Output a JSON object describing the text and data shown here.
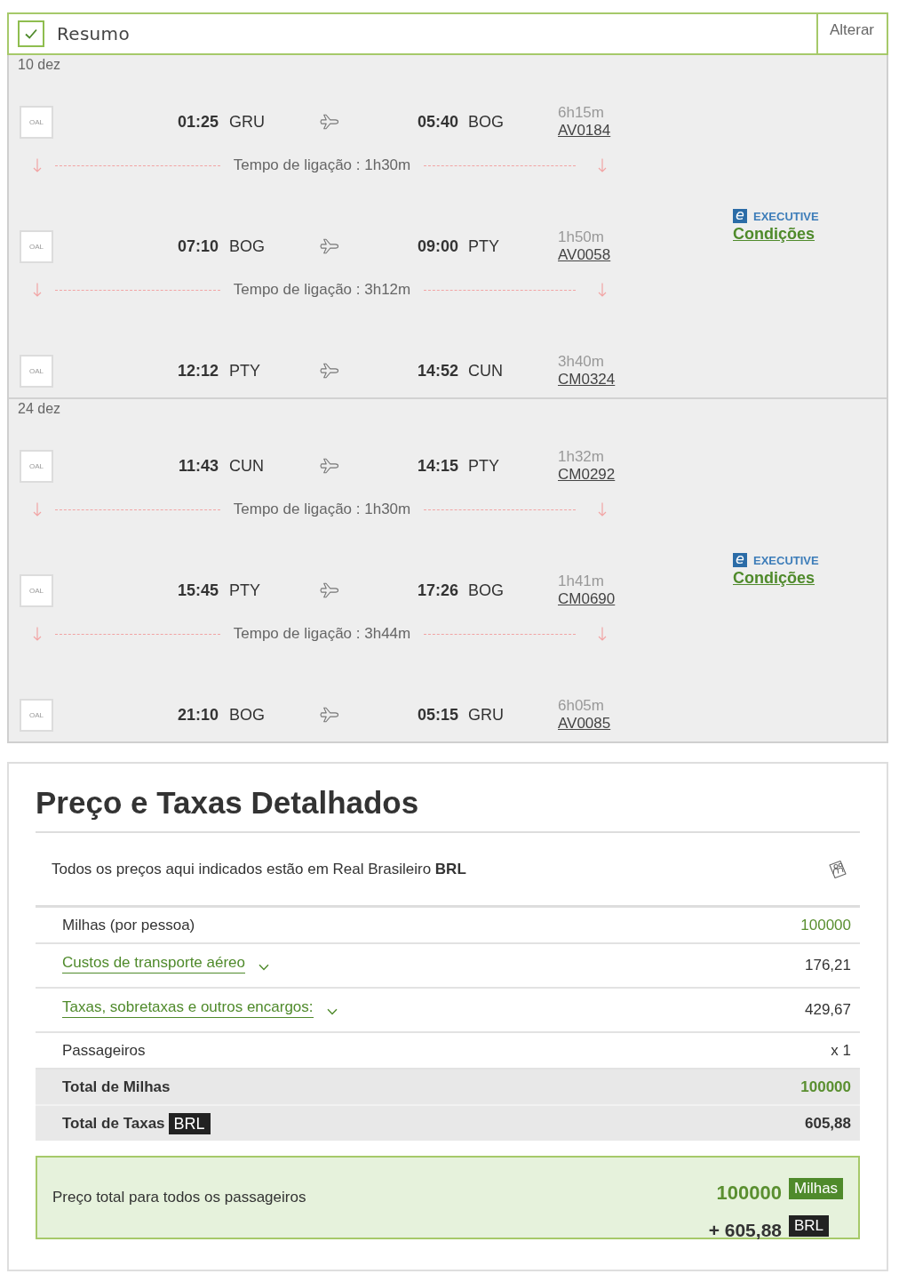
{
  "summary": {
    "checked": true,
    "title": "Resumo",
    "action": "Alterar"
  },
  "bounds": [
    {
      "date": "10 dez",
      "fare": {
        "icon_letter": "e",
        "cabin": "EXECUTIVE",
        "link": "Condições"
      },
      "segments": [
        {
          "logo": "OAL",
          "departure_time": "01:25",
          "departure_airport": "GRU",
          "arrival_time": "05:40",
          "arrival_airport": "BOG",
          "duration": "6h15m",
          "flight": "AV0184",
          "connection": "Tempo de ligação : 1h30m"
        },
        {
          "logo": "OAL",
          "departure_time": "07:10",
          "departure_airport": "BOG",
          "arrival_time": "09:00",
          "arrival_airport": "PTY",
          "duration": "1h50m",
          "flight": "AV0058",
          "connection": "Tempo de ligação : 3h12m"
        },
        {
          "logo": "OAL",
          "departure_time": "12:12",
          "departure_airport": "PTY",
          "arrival_time": "14:52",
          "arrival_airport": "CUN",
          "duration": "3h40m",
          "flight": "CM0324"
        }
      ]
    },
    {
      "date": "24 dez",
      "fare": {
        "icon_letter": "e",
        "cabin": "EXECUTIVE",
        "link": "Condições"
      },
      "segments": [
        {
          "logo": "OAL",
          "departure_time": "11:43",
          "departure_airport": "CUN",
          "arrival_time": "14:15",
          "arrival_airport": "PTY",
          "duration": "1h32m",
          "flight": "CM0292",
          "connection": "Tempo de ligação : 1h30m"
        },
        {
          "logo": "OAL",
          "departure_time": "15:45",
          "departure_airport": "PTY",
          "arrival_time": "17:26",
          "arrival_airport": "BOG",
          "duration": "1h41m",
          "flight": "CM0690",
          "connection": "Tempo de ligação : 3h44m"
        },
        {
          "logo": "OAL",
          "departure_time": "21:10",
          "departure_airport": "BOG",
          "arrival_time": "05:15",
          "arrival_airport": "GRU",
          "duration": "6h05m",
          "flight": "AV0085"
        }
      ]
    }
  ],
  "price_details": {
    "title": "Preço e Taxas Detalhados",
    "currency_note": "Todos os preços aqui indicados estão em Real Brasileiro **BRL**",
    "rows": [
      {
        "kind": "miles",
        "label": "Milhas (por pessoa)",
        "value": "100000"
      },
      {
        "kind": "expandable",
        "label": "Custos de transporte aéreo",
        "value": "176,21",
        "expanded": false
      },
      {
        "kind": "expandable",
        "label": "Taxas, sobretaxas e outros encargos:",
        "value": "429,67",
        "expanded": false
      },
      {
        "kind": "plain",
        "label": "Passageiros",
        "value": "x 1"
      },
      {
        "kind": "total_miles",
        "label": "Total de Milhas",
        "value": "100000"
      },
      {
        "kind": "total_taxes",
        "label": "Total de Taxas",
        "badge": "BRL",
        "value": "605,88"
      }
    ],
    "total": {
      "label": "Preço total para todos os passageiros",
      "miles": "100000",
      "miles_unit": "Milhas",
      "taxes": "+ 605,88",
      "taxes_unit": "BRL"
    }
  }
}
